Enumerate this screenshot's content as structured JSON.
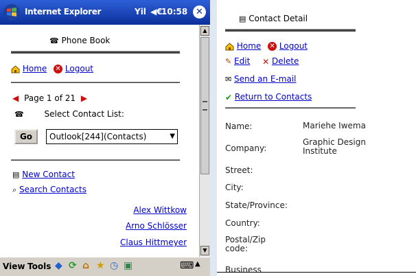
{
  "left": {
    "titlebar": {
      "app_title": "Internet Explorer",
      "clock": "10:58",
      "signal_label": "Yil",
      "speaker_label": "◀€"
    },
    "page_header": "Phone Book",
    "nav": {
      "home": "Home",
      "logout": "Logout"
    },
    "pager": {
      "text": "Page 1 of 21"
    },
    "select_label": "Select Contact List:",
    "go_button": "Go",
    "contact_list_selected": "Outlook[244](Contacts)",
    "links": {
      "new_contact": "New Contact",
      "search_contacts": "Search Contacts"
    },
    "contacts": [
      "Alex Wittkow",
      "Arno Schlösser",
      "Claus Hittmeyer"
    ],
    "taskbar": {
      "view": "View",
      "tools": "Tools"
    }
  },
  "right": {
    "header": "Contact Detail",
    "nav": {
      "home": "Home",
      "logout": "Logout",
      "edit": "Edit",
      "delete": "Delete",
      "send_email": "Send an E-mail",
      "return": "Return to Contacts"
    },
    "fields": [
      {
        "label": "Name:",
        "value": "Mariehe Iwema"
      },
      {
        "label": "Company:",
        "value": "Graphic Design Institute"
      },
      {
        "label": "Street:",
        "value": ""
      },
      {
        "label": "City:",
        "value": ""
      },
      {
        "label": "State/Province:",
        "value": ""
      },
      {
        "label": "Country:",
        "value": ""
      },
      {
        "label": "Postal/Zip code:",
        "value": ""
      },
      {
        "label": "Business",
        "value": ""
      }
    ]
  }
}
